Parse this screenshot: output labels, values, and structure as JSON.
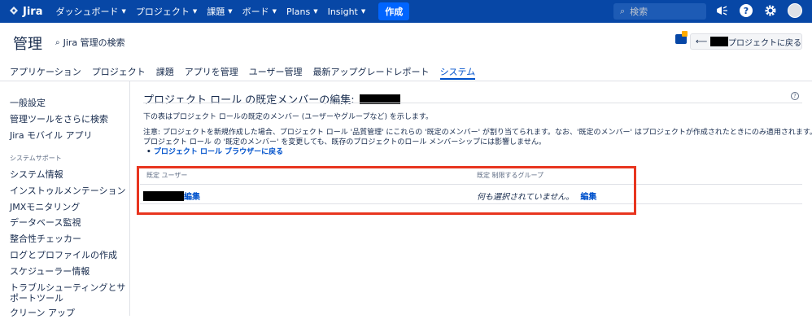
{
  "topnav": {
    "logo_text": "Jira",
    "items": [
      {
        "label": "ダッシュボード",
        "has_menu": true
      },
      {
        "label": "プロジェクト",
        "has_menu": true
      },
      {
        "label": "課題",
        "has_menu": true
      },
      {
        "label": "ボード",
        "has_menu": true
      },
      {
        "label": "Plans",
        "has_menu": true
      },
      {
        "label": "Insight",
        "has_menu": true
      }
    ],
    "create_label": "作成",
    "search_placeholder": "検索",
    "icons": [
      "megaphone-icon",
      "help-icon",
      "gear-icon",
      "avatar"
    ],
    "bar_color": "#0747a6"
  },
  "admin": {
    "title": "管理",
    "search_label": "Jira 管理の検索",
    "back_button_label": "プロジェクトに戻る"
  },
  "tabs": [
    {
      "label": "アプリケーション",
      "active": false
    },
    {
      "label": "プロジェクト",
      "active": false
    },
    {
      "label": "課題",
      "active": false
    },
    {
      "label": "アプリを管理",
      "active": false
    },
    {
      "label": "ユーザー管理",
      "active": false
    },
    {
      "label": "最新アップグレードレポート",
      "active": false
    },
    {
      "label": "システム",
      "active": true
    }
  ],
  "sidebar": {
    "items": [
      {
        "label": "一般設定"
      },
      {
        "label": "管理ツールをさらに検索"
      },
      {
        "label": "Jira モバイル アプリ"
      }
    ],
    "section_heading": "システムサポート",
    "support_items": [
      {
        "label": "システム情報"
      },
      {
        "label": "インストゥルメンテーション"
      },
      {
        "label": "JMXモニタリング"
      },
      {
        "label": "データベース監視"
      },
      {
        "label": "整合性チェッカー"
      },
      {
        "label": "ログとプロファイルの作成"
      },
      {
        "label": "スケジューラー情報"
      },
      {
        "label": "トラブルシューティングとサ"
      },
      {
        "label": "ポートツール"
      },
      {
        "label": "クリーン アップ"
      }
    ]
  },
  "main": {
    "heading": "プロジェクト ロール の既定メンバーの編集:",
    "description": "下の表はプロジェクト ロールの既定のメンバー (ユーザーやグループなど) を示します。",
    "note_line1": "注意: プロジェクトを新規作成した場合、プロジェクト ロール '品質管理' にこれらの '既定のメンバー' が割り当てられます。なお、'既定のメンバー' はプロジェクトが作成されたときにのみ適用されます。",
    "note_line2": "プロジェクト ロール の '既定のメンバー' を変更しても、既存のプロジェクトのロール メンバーシップには影響しません。",
    "browser_link": "プロジェクト ロール ブラウザーに戻る",
    "table": {
      "col_users": "既定 ユーザー",
      "col_groups": "既定 制限するグループ",
      "users_edit": "編集",
      "groups_value": "何も選択されていません。",
      "groups_edit": "編集"
    },
    "highlight_color": "#e8351f"
  }
}
